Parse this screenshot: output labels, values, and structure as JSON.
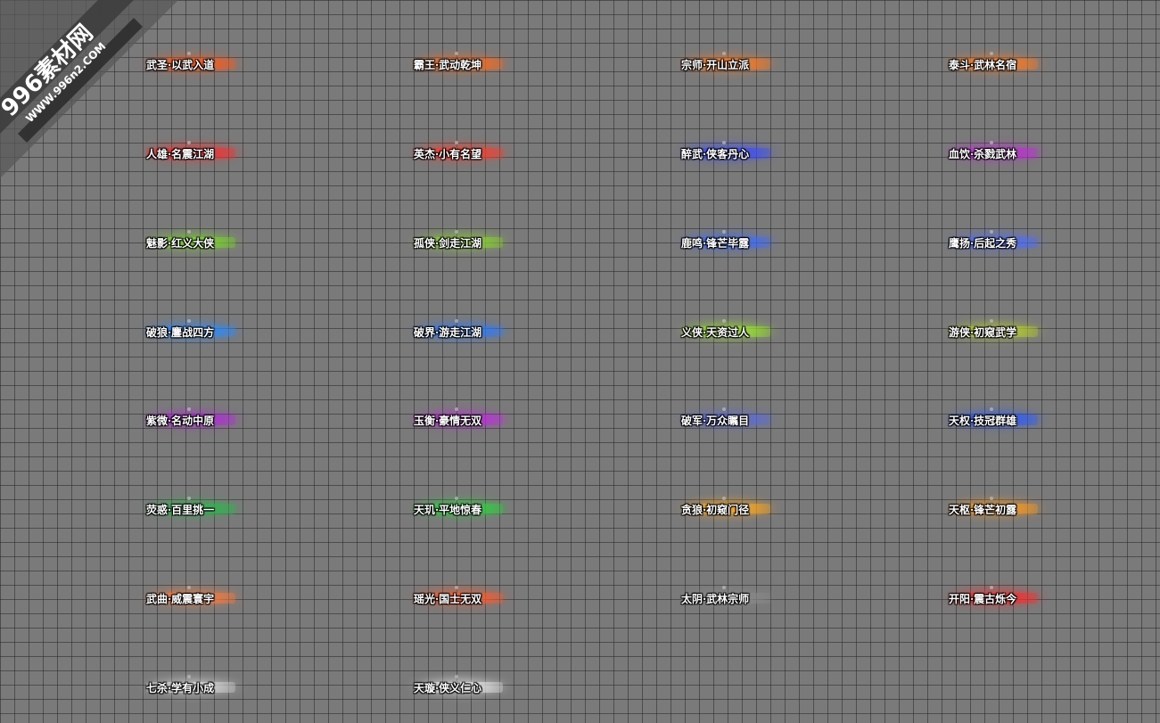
{
  "watermark": {
    "brand": "996素材网",
    "url": "WWW.996n2.COM"
  },
  "titles": [
    {
      "text": "武圣·以武入道",
      "color": "#ff5a1a"
    },
    {
      "text": "霸王·武动乾坤",
      "color": "#ff6a1a"
    },
    {
      "text": "宗师·开山立派",
      "color": "#ff7a1f"
    },
    {
      "text": "泰斗·武林名宿",
      "color": "#ff7a1f"
    },
    {
      "text": "人雄·名震江湖",
      "color": "#ff2a2a"
    },
    {
      "text": "英杰·小有名望",
      "color": "#ff3a2a"
    },
    {
      "text": "醉武·侠客丹心",
      "color": "#3a4bff"
    },
    {
      "text": "血饮·杀戮武林",
      "color": "#c02ad8"
    },
    {
      "text": "魅影·红义大侠",
      "color": "#7ad62a"
    },
    {
      "text": "孤侠·剑走江湖",
      "color": "#8ad62a"
    },
    {
      "text": "鹿鸣·锋芒毕露",
      "color": "#3a6bff"
    },
    {
      "text": "鹰扬·后起之秀",
      "color": "#4a6bff"
    },
    {
      "text": "破狼·鏖战四方",
      "color": "#2a8bff"
    },
    {
      "text": "破界·游走江湖",
      "color": "#2a7bff"
    },
    {
      "text": "义侠·天资过人",
      "color": "#9ae62a"
    },
    {
      "text": "游侠·初窥武学",
      "color": "#b8d02a"
    },
    {
      "text": "紫微·名动中原",
      "color": "#b02ad8"
    },
    {
      "text": "玉衡·豪情无双",
      "color": "#c02ae0"
    },
    {
      "text": "破军·万众瞩目",
      "color": "#5a6bd8"
    },
    {
      "text": "天权·技冠群雄",
      "color": "#2a5bff"
    },
    {
      "text": "荧惑·百里挑一",
      "color": "#2ab84a"
    },
    {
      "text": "天玑·平地惊春",
      "color": "#2ad63a"
    },
    {
      "text": "贪狼·初窥门径",
      "color": "#ffa81a"
    },
    {
      "text": "天枢·锋芒初露",
      "color": "#ff9a1a"
    },
    {
      "text": "武曲·威震寰宇",
      "color": "#ff7a3a"
    },
    {
      "text": "瑶光·国士无双",
      "color": "#ff5a2a"
    },
    {
      "text": "太阴·武林宗师",
      "color": "#8a8a8a"
    },
    {
      "text": "开阳·震古烁今",
      "color": "#ff2a2a"
    },
    {
      "text": "七杀·学有小成",
      "color": "#d8d8d8"
    },
    {
      "text": "天璇·侠义仁心",
      "color": "#e8e8e8"
    }
  ]
}
